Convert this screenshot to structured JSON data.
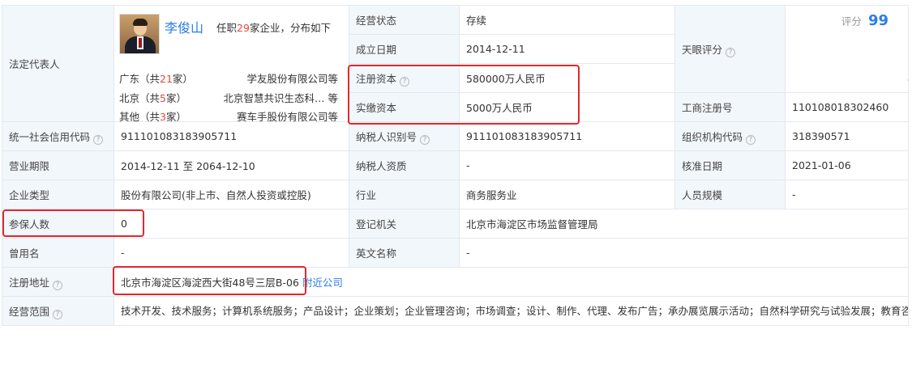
{
  "labels": {
    "legal_rep": "法定代表人",
    "status": "经营状态",
    "founded": "成立日期",
    "reg_capital": "注册资本",
    "paid_capital": "实缴资本",
    "tianyan_score": "天眼评分",
    "biz_reg_no": "工商注册号",
    "credit_code": "统一社会信用代码",
    "taxpayer_id": "纳税人识别号",
    "org_code": "组织机构代码",
    "biz_term": "营业期限",
    "taxpayer_qual": "纳税人资质",
    "approval_date": "核准日期",
    "company_type": "企业类型",
    "industry": "行业",
    "staff_size": "人员规模",
    "insured": "参保人数",
    "reg_authority": "登记机关",
    "former_name": "曾用名",
    "english_name": "英文名称",
    "reg_address": "注册地址",
    "biz_scope": "经营范围"
  },
  "legal_rep": {
    "name": "李俊山",
    "desc_prefix": "任职",
    "count": "29",
    "desc_suffix": "家企业，分布如下",
    "provinces": [
      {
        "prefix": "广东（共",
        "count": "21",
        "suffix": "家）",
        "company": "学友股份有限公司等"
      },
      {
        "prefix": "北京（共",
        "count": "5",
        "suffix": "家）",
        "company": "北京智慧共识生态科… 等"
      },
      {
        "prefix": "其他（共",
        "count": "3",
        "suffix": "家）",
        "company": "赛车手股份有限公司等"
      }
    ]
  },
  "values": {
    "status": "存续",
    "founded": "2014-12-11",
    "reg_capital": "580000万人民币",
    "paid_capital": "5000万人民币",
    "biz_reg_no": "110108018302460",
    "credit_code": "911101083183905711",
    "taxpayer_id": "911101083183905711",
    "org_code": "318390571",
    "biz_term": "2014-12-11 至 2064-12-10",
    "taxpayer_qual": "-",
    "approval_date": "2021-01-06",
    "company_type": "股份有限公司(非上市、自然人投资或控股)",
    "industry": "商务服务业",
    "staff_size": "-",
    "insured": "0",
    "reg_authority": "北京市海淀区市场监督管理局",
    "former_name": "-",
    "english_name": "-",
    "reg_address": "北京市海淀区海淀西大街48号三层B-06",
    "nearby_link": "附近公司",
    "biz_scope": "技术开发、技术服务；计算机系统服务；产品设计；企业策划；企业管理咨询；市场调查；设计、制作、代理、发布广告；承办展览展示活动；自然科学研究与试验发展；教育咨询（中介服务除外）；经济贸易咨询；文化咨询；公共关系服务；会议服务；组织文化艺术交流活动（不含营业性演出）；文艺创作；影视策划；翻译服务；数据处理（数据处理中的银行卡中心、PUE值在1.5以上的云计算数据中心除外）。（市场主体依法自主选择经营项目，开展经营活动；依法须经批准的项目，经相关部门批准后依批准的内容开展经营活动；不得从事国家和本市产业政策禁止和限制类项目的经营活动。）"
  },
  "score": {
    "label": "评分",
    "value": "99",
    "percentile_value": 99,
    "axis_ticks": [
      "0",
      "1",
      "3",
      "15",
      "50",
      "85",
      "97",
      "99",
      "100"
    ]
  },
  "colors": {
    "link": "#2b7de9",
    "highlight": "#e0282c",
    "label_bg": "#f2f7fc"
  }
}
